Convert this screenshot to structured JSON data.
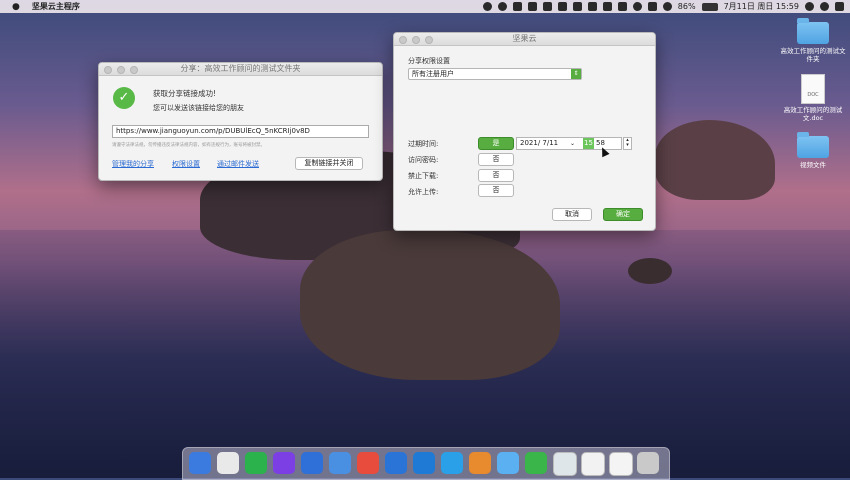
{
  "menubar": {
    "app_name": "坚果云主程序",
    "battery": "86%",
    "datetime": "7月11日 周日  15:59"
  },
  "share_window": {
    "title": "分享：高效工作顾问的测试文件夹",
    "success_title": "获取分享链接成功!",
    "success_sub": "您可以发送该链接给您的朋友",
    "url": "https://www.jianguoyun.com/p/DUBUlEcQ_5nKCRIj0v8D",
    "notice": "请遵守法律法规，勿传播违反法律法规内容，如有违规行为，账号将被封禁。",
    "link_manage": "管理我的分享",
    "link_permission": "权限设置",
    "link_email": "通过邮件发送",
    "copy_close": "复制链接并关闭"
  },
  "perm_window": {
    "title": "坚果云",
    "section": "分享权限设置",
    "select_value": "所有注册用户",
    "expire_label": "过期时间:",
    "expire_yes": "是",
    "date_value": "2021/  7/11",
    "time_hour": "15",
    "time_min": "58",
    "password_label": "访问密码:",
    "password_value": "否",
    "nodownload_label": "禁止下载:",
    "nodownload_value": "否",
    "upload_label": "允许上传:",
    "upload_value": "否",
    "cancel": "取消",
    "ok": "确定"
  },
  "desktop_icons": [
    {
      "label": "高效工作顾问的测试文件夹",
      "kind": "folder"
    },
    {
      "label": "高效工作顾问的测试文.doc",
      "kind": "doc",
      "badge": "DOC"
    },
    {
      "label": "视频文件",
      "kind": "folder"
    }
  ],
  "dock_colors": [
    "#3b7be0",
    "#e9e9e9",
    "#2bb24c",
    "#7b3fe4",
    "#2f6fd8",
    "#4a90e2",
    "#e74c3c",
    "#2a74d8",
    "#1f7ad6",
    "#2aa0e8",
    "#e88a2e",
    "#5ab0f0",
    "#39b54a",
    "#dfe6ea",
    "#f2f2f2",
    "#f4f4f4",
    "#c9c9c9"
  ]
}
